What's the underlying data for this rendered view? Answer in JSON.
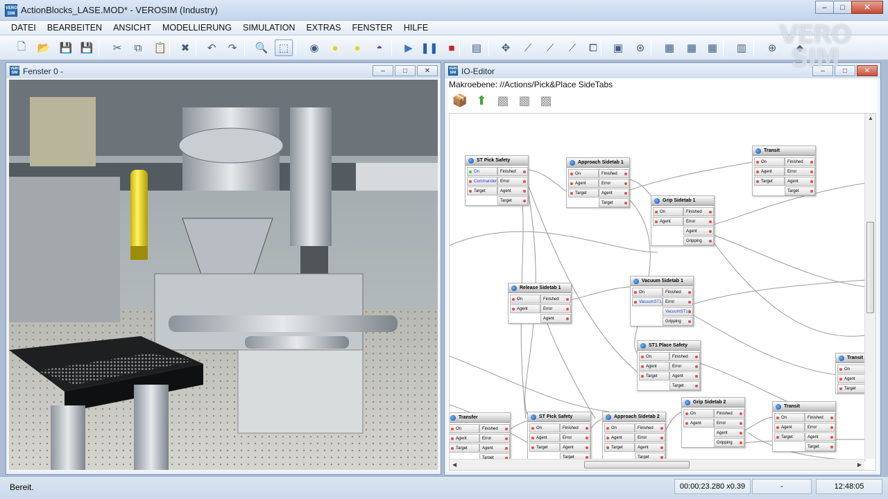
{
  "app": {
    "title": "ActionBlocks_LASE.MOD* - VEROSIM (Industry)",
    "logo_text": "VERO SIM",
    "watermark": "VEROSIM"
  },
  "window_controls": {
    "minimize": "–",
    "maximize": "□",
    "close": "✕"
  },
  "menu": [
    "DATEI",
    "BEARBEITEN",
    "ANSICHT",
    "MODELLIERUNG",
    "SIMULATION",
    "EXTRAS",
    "FENSTER",
    "HILFE"
  ],
  "toolbar": {
    "icons": [
      "new-file-icon",
      "open-folder-icon",
      "save-icon",
      "save-all-icon",
      "cut-icon",
      "copy-icon",
      "paste-icon",
      "delete-icon",
      "undo-icon",
      "redo-icon",
      "zoom-icon",
      "select-icon",
      "render-mode-1-icon",
      "render-mode-2-icon",
      "render-mode-3-icon",
      "render-mode-4-icon",
      "play-icon",
      "pause-icon",
      "stop-icon",
      "record-icon",
      "move-icon",
      "axes-1-icon",
      "axes-2-icon",
      "axes-3-icon",
      "frame-icon",
      "camera-icon",
      "link-icon",
      "robot-1-icon",
      "robot-2-icon",
      "robot-3-icon",
      "ecorn-icon",
      "grid-icon",
      "tool-icon"
    ],
    "glyphs": [
      "🗋",
      "📂",
      "💾",
      "💾",
      "✂",
      "⧉",
      "📋",
      "✖",
      "↶",
      "↷",
      "🔍",
      "⬚",
      "◉",
      "●",
      "●",
      "◓",
      "▶",
      "❚❚",
      "■",
      "▤",
      "✥",
      "⟋",
      "⟋",
      "⟋",
      "⧠",
      "▣",
      "⊛",
      "▦",
      "▦",
      "▦",
      "▥",
      "⊕",
      "⬥"
    ],
    "active_index": 11,
    "colors": {
      "play": "#3c78c0",
      "pause": "#1f5fb0",
      "stop": "#cc2020",
      "yellow": "#e6d21a",
      "purple": "#6a2fb0"
    }
  },
  "left_window": {
    "title": "Fenster 0 -",
    "controls": {
      "minimize": "–",
      "maximize": "□",
      "close": "✕"
    }
  },
  "io_editor": {
    "title": "IO-Editor",
    "makroebene": "Makroebene: //Actions/Pick&Place SideTabs",
    "tools": [
      "folder-icon",
      "up-arrow-icon",
      "delete-block-icon",
      "block-1-icon",
      "block-2-icon"
    ],
    "tool_glyphs": [
      "📦",
      "⬆",
      "▩",
      "▩",
      "▩"
    ],
    "blocks": [
      {
        "title": "ST Pick Safety",
        "inputs": [
          "On",
          "CommanderA",
          "Target"
        ],
        "outputs": [
          "Finished",
          "Error",
          "Agent",
          "Target"
        ],
        "input_ok": [
          true,
          false,
          false
        ],
        "input_blue": [
          true,
          true,
          false
        ]
      },
      {
        "title": "Approach Sidetab 1",
        "inputs": [
          "On",
          "Agent",
          "Target"
        ],
        "outputs": [
          "Finished",
          "Error",
          "Agent",
          "Target"
        ]
      },
      {
        "title": "Transit",
        "inputs": [
          "On",
          "Agent",
          "Target"
        ],
        "outputs": [
          "Finished",
          "Error",
          "Agent",
          "Target"
        ]
      },
      {
        "title": "Grip Sidetab 1",
        "inputs": [
          "On",
          "Agent"
        ],
        "outputs": [
          "Finished",
          "Error",
          "Agent",
          "Gripping"
        ]
      },
      {
        "title": "Release Sidetab 1",
        "inputs": [
          "On",
          "Agent"
        ],
        "outputs": [
          "Finished",
          "Error",
          "Agent"
        ]
      },
      {
        "title": "Vacuum Sidetab 1",
        "inputs": [
          "On",
          "VacuumST1A"
        ],
        "outputs": [
          "Finished",
          "Error",
          "VacuumST1A",
          "Gripping"
        ],
        "input_blue": [
          false,
          true
        ],
        "output_blue": [
          false,
          false,
          true,
          false
        ]
      },
      {
        "title": "ST1 Place Safety",
        "inputs": [
          "On",
          "Agent",
          "Target"
        ],
        "outputs": [
          "Finished",
          "Error",
          "Agent",
          "Target"
        ]
      },
      {
        "title": "Transit",
        "inputs": [
          "On",
          "Agent",
          "Target"
        ],
        "outputs": []
      },
      {
        "title": "Transfer",
        "inputs": [
          "On",
          "Agent",
          "Target"
        ],
        "outputs": [
          "Finished",
          "Error",
          "Agent",
          "Target"
        ]
      },
      {
        "title": "ST Pick Safety",
        "inputs": [
          "On",
          "Agent",
          "Target"
        ],
        "outputs": [
          "Finished",
          "Error",
          "Agent",
          "Target"
        ]
      },
      {
        "title": "Approach Sidetab 2",
        "inputs": [
          "On",
          "Agent",
          "Target"
        ],
        "outputs": [
          "Finished",
          "Error",
          "Agent",
          "Target"
        ]
      },
      {
        "title": "Grip Sidetab 2",
        "inputs": [
          "On",
          "Agent"
        ],
        "outputs": [
          "Finished",
          "Error",
          "Agent",
          "Gripping"
        ]
      },
      {
        "title": "Transit",
        "inputs": [
          "On",
          "Agent",
          "Target"
        ],
        "outputs": [
          "Finished",
          "Error",
          "Agent",
          "Target"
        ]
      }
    ]
  },
  "status": {
    "text": "Bereit.",
    "time": "00:00:23.280",
    "speed": "x0.39",
    "mode": "-",
    "clock": "12:48:05"
  }
}
